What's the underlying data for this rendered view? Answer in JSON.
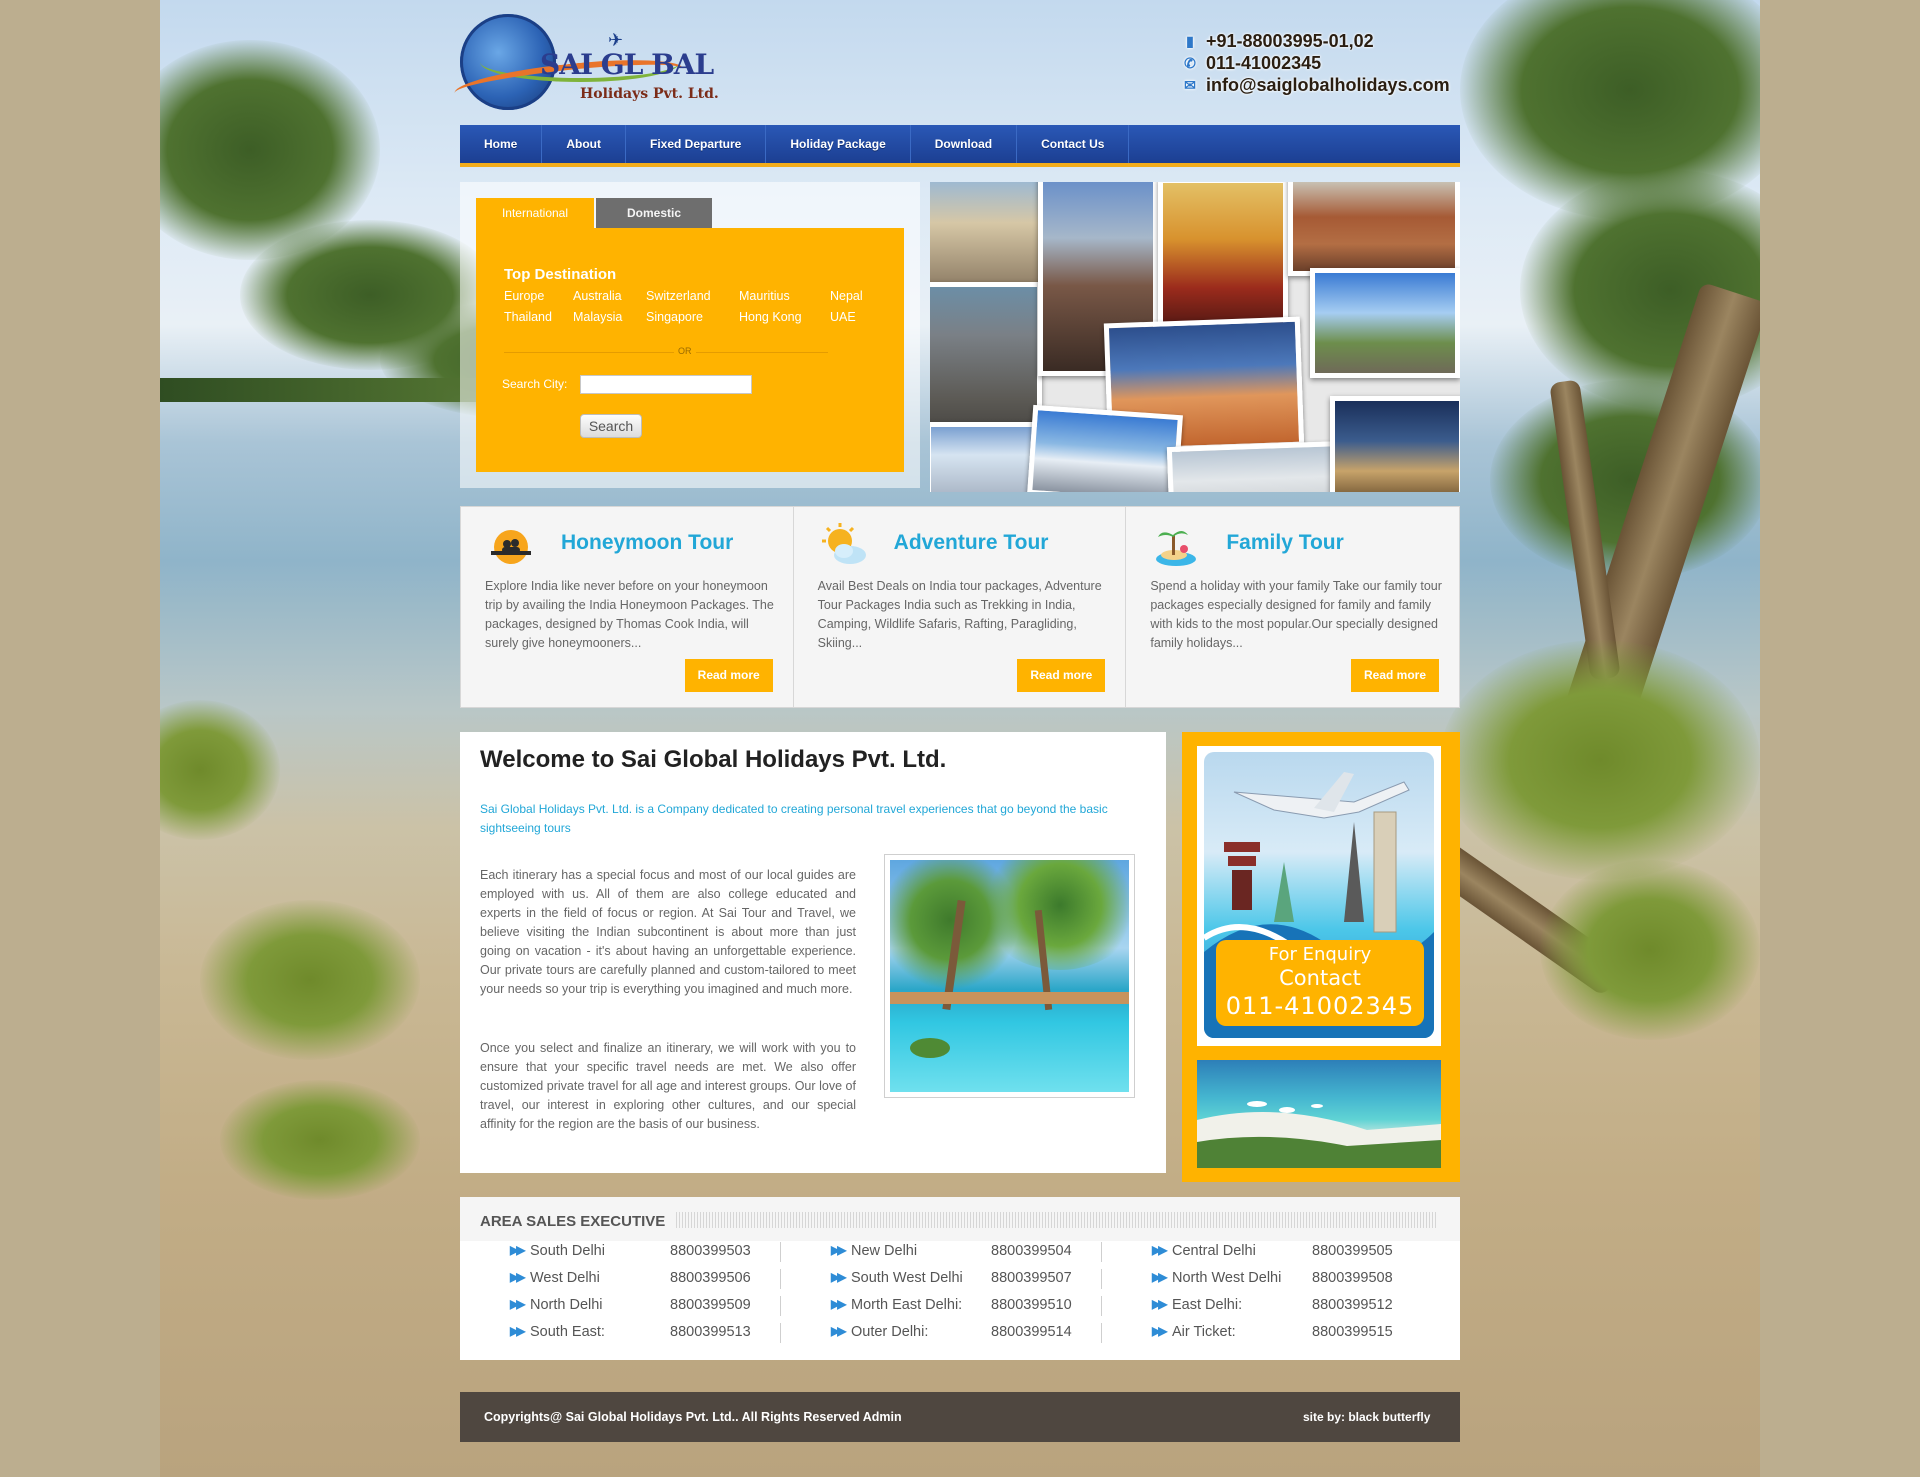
{
  "header": {
    "logo_main": "SAI GL BAL",
    "logo_sub": "Holidays Pvt. Ltd.",
    "phone_mobile": "+91-88003995-01,02",
    "phone_landline": "011-41002345",
    "email": "info@saiglobalholidays.com"
  },
  "nav": [
    "Home",
    "About",
    "Fixed Departure",
    "Holiday Package",
    "Download",
    "Contact Us"
  ],
  "search": {
    "tab_international": "International",
    "tab_domestic": "Domestic",
    "top_destination_label": "Top Destination",
    "destinations_row1": [
      "Europe",
      "Australia",
      "Switzerland",
      "Mauritius",
      "Nepal"
    ],
    "destinations_row2": [
      "Thailand",
      "Malaysia",
      "Singapore",
      "Hong Kong",
      "UAE"
    ],
    "or_label": "OR",
    "city_label": "Search City:",
    "city_value": "",
    "button_label": "Search"
  },
  "features": [
    {
      "title": "Honeymoon Tour",
      "icon": "couple-sunset-icon",
      "text": "Explore India like never before on your honeymoon trip by availing the India Honeymoon Packages. The packages, designed by Thomas Cook India, will surely give honeymooners...",
      "button": "Read more"
    },
    {
      "title": "Adventure Tour",
      "icon": "sun-cloud-icon",
      "text": "Avail Best Deals on India tour packages, Adventure Tour Packages India such as Trekking in India, Camping, Wildlife Safaris, Rafting, Paragliding, Skiing...",
      "button": "Read more"
    },
    {
      "title": "Family Tour",
      "icon": "beach-island-icon",
      "text": "Spend a holiday with your family Take our family tour packages especially designed for family and family with kids to the most popular.Our specially designed family holidays...",
      "button": "Read more"
    }
  ],
  "welcome": {
    "title": "Welcome to Sai Global Holidays Pvt. Ltd.",
    "intro": "Sai Global Holidays Pvt. Ltd. is a Company dedicated to creating personal travel experiences that go beyond the basic sightseeing tours",
    "para1": "Each itinerary has a special focus and most of our local guides are employed with us. All of them are also college educated and experts in the field of focus or region. At Sai Tour and Travel, we believe visiting the Indian subcontinent is about more than just going on vacation - it's about having an unforgettable experience. Our private tours are carefully planned and custom-tailored to meet your needs so your trip is everything you imagined and much more.",
    "para2": "Once you select and finalize an itinerary, we will work with you to ensure that your specific travel needs are met. We also offer customized private travel for all age and interest groups. Our love of travel, our interest in exploring other cultures, and our special affinity for the region are the basis of our business."
  },
  "enquiry": {
    "line1": "For Enquiry",
    "line2": "Contact",
    "line3": "011-41002345"
  },
  "sales": {
    "title": "AREA SALES EXECUTIVE",
    "entries": [
      {
        "area": "South Delhi",
        "phone": "8800399503"
      },
      {
        "area": "New Delhi",
        "phone": "8800399504"
      },
      {
        "area": "Central Delhi",
        "phone": "8800399505"
      },
      {
        "area": "West Delhi",
        "phone": "8800399506"
      },
      {
        "area": "South West Delhi",
        "phone": "8800399507"
      },
      {
        "area": "North West Delhi",
        "phone": "8800399508"
      },
      {
        "area": "North Delhi",
        "phone": "8800399509"
      },
      {
        "area": "Morth East Delhi:",
        "phone": "8800399510"
      },
      {
        "area": "East Delhi:",
        "phone": "8800399512"
      },
      {
        "area": "South East:",
        "phone": "8800399513"
      },
      {
        "area": "Outer Delhi:",
        "phone": "8800399514"
      },
      {
        "area": "Air Ticket:",
        "phone": "8800399515"
      }
    ]
  },
  "footer": {
    "copyright": "Copyrights@ Sai Global Holidays Pvt. Ltd.. All Rights Reserved Admin",
    "site_by": "site by: black butterfly"
  },
  "colors": {
    "accent_yellow": "#ffb300",
    "nav_blue": "#1c3f92",
    "link_blue": "#22a7d7",
    "footer_brown": "#4f4740"
  }
}
